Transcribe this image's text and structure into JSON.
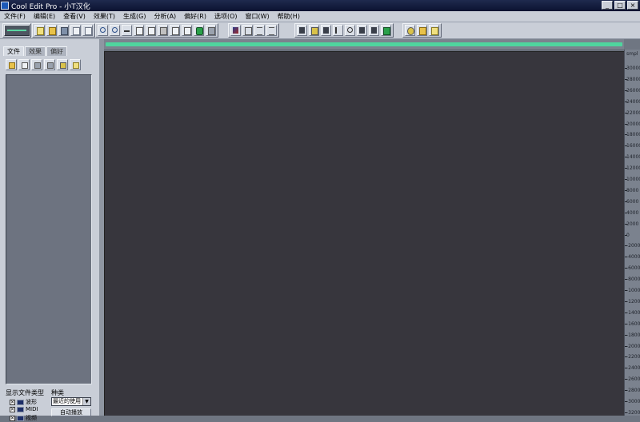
{
  "window": {
    "title": "Cool Edit Pro  - 小T汉化",
    "controls": [
      "_",
      "□",
      "×"
    ]
  },
  "menu": [
    "文件(F)",
    "编辑(E)",
    "查看(V)",
    "效果(T)",
    "生成(G)",
    "分析(A)",
    "偏好(R)",
    "选项(O)",
    "窗口(W)",
    "帮助(H)"
  ],
  "toolbar": {
    "groups": [
      {
        "buttons": [
          "wave-multitrack-toggle-icon"
        ]
      },
      {
        "buttons": [
          "new-file-icon",
          "open-folder-icon",
          "save-icon",
          "save-as-icon",
          "close-file-icon"
        ]
      },
      {
        "buttons": [
          "undo-icon",
          "redo-icon",
          "cut-icon",
          "copy-icon",
          "paste-icon",
          "trim-icon",
          "mix-paste-icon",
          "paste-new-icon",
          "record-enable-icon",
          "mono-icon"
        ]
      },
      {
        "buttons": [
          "spectral-view-icon",
          "loop-icon",
          "cue-list-icon",
          "play-list-icon"
        ]
      },
      {
        "buttons": [
          "horizontal-icon",
          "frequency-icon",
          "waveform-icon",
          "envelope-icon",
          "track-properties-icon",
          "mixer-icon",
          "playlist-icon",
          "settings-icon"
        ]
      },
      {
        "buttons": [
          "cd-icon",
          "notes-icon",
          "help-icon"
        ]
      }
    ]
  },
  "leftpanel": {
    "tabs": [
      "文件",
      "效果",
      "偏好"
    ],
    "buttons": [
      "open-file-icon",
      "import-icon",
      "close-icon",
      "insert-icon",
      "edit-icon",
      "help-icon"
    ],
    "show_label": "显示文件类型",
    "sort_label": "种类",
    "types": [
      {
        "label": "波形",
        "checked": "✕"
      },
      {
        "label": "MIDI",
        "checked": "✕"
      },
      {
        "label": "视频",
        "checked": "✕"
      }
    ],
    "sort_value": "最近的使用",
    "sort_arrow": "▼",
    "autoplay_label": "自动播放"
  },
  "ruler": {
    "unit": "smpl",
    "labels": [
      "30000",
      "28000",
      "26000",
      "24000",
      "22000",
      "20000",
      "18000",
      "16000",
      "14000",
      "12000",
      "10000",
      "8000",
      "6000",
      "4000",
      "2000",
      "0",
      "-2000",
      "-4000",
      "-6000",
      "-8000",
      "-10000",
      "-12000",
      "-14000",
      "-16000",
      "-18000",
      "-20000",
      "-22000",
      "-24000",
      "-26000",
      "-28000",
      "-30000",
      "-32000"
    ]
  },
  "colors": {
    "waveform_bg": "#37363d",
    "overview_bar": "#4fd59e",
    "chrome": "#c9ced7",
    "titlebar": "#0b1230"
  }
}
